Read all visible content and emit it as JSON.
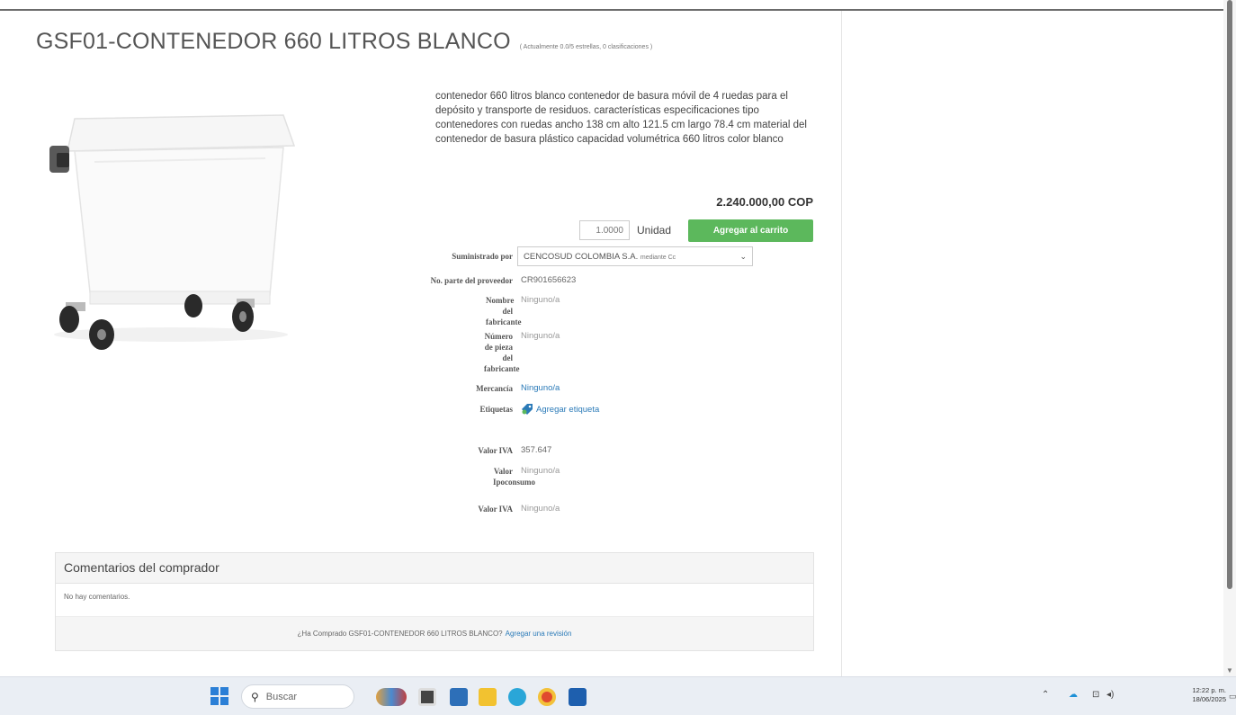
{
  "product": {
    "title": "GSF01-CONTENEDOR 660 LITROS BLANCO",
    "rating_text": "( Actualmente 0.0/5 estrellas, 0 clasificaciones )",
    "description": "contenedor 660 litros blanco contenedor de basura móvil de 4 ruedas para el depósito y transporte de residuos. características especificaciones tipo contenedores con ruedas ancho 138 cm alto 121.5 cm largo 78.4 cm material del contenedor de basura plástico capacidad volumétrica 660 litros color blanco",
    "price": "2.240.000,00 COP",
    "quantity": "1.0000",
    "unit": "Unidad",
    "add_to_cart_label": "Agregar al carrito"
  },
  "details": {
    "supplier_label": "Suministrado por",
    "supplier_value": "CENCOSUD COLOMBIA S.A.",
    "supplier_sub": "mediante Cc",
    "part_no_label": "No. parte del proveedor",
    "part_no_value": "CR901656623",
    "manufacturer_label": "Nombre del fabricante",
    "manufacturer_value": "Ninguno/a",
    "manufacturer_part_label": "Número de pieza del fabricante",
    "manufacturer_part_value": "Ninguno/a",
    "commodity_label": "Mercancía",
    "commodity_value": "Ninguno/a",
    "tags_label": "Etiquetas",
    "tags_value": "Agregar etiqueta",
    "iva_label": "Valor IVA",
    "iva_value": "357.647",
    "ipoconsumo_label": "Valor Ipoconsumo",
    "ipoconsumo_value": "Ninguno/a",
    "iva2_label": "Valor IVA",
    "iva2_value": "Ninguno/a"
  },
  "comments": {
    "title": "Comentarios del comprador",
    "empty_text": "No hay comentarios.",
    "prompt": "¿Ha Comprado GSF01-CONTENEDOR 660 LITROS BLANCO?",
    "review_link": "Agregar una revisión"
  },
  "taskbar": {
    "search_placeholder": "Buscar",
    "time": "12:22 p. m.",
    "date": "18/06/2025"
  },
  "colors": {
    "accent_green": "#5cb85c",
    "link_blue": "#2a7ab8"
  }
}
